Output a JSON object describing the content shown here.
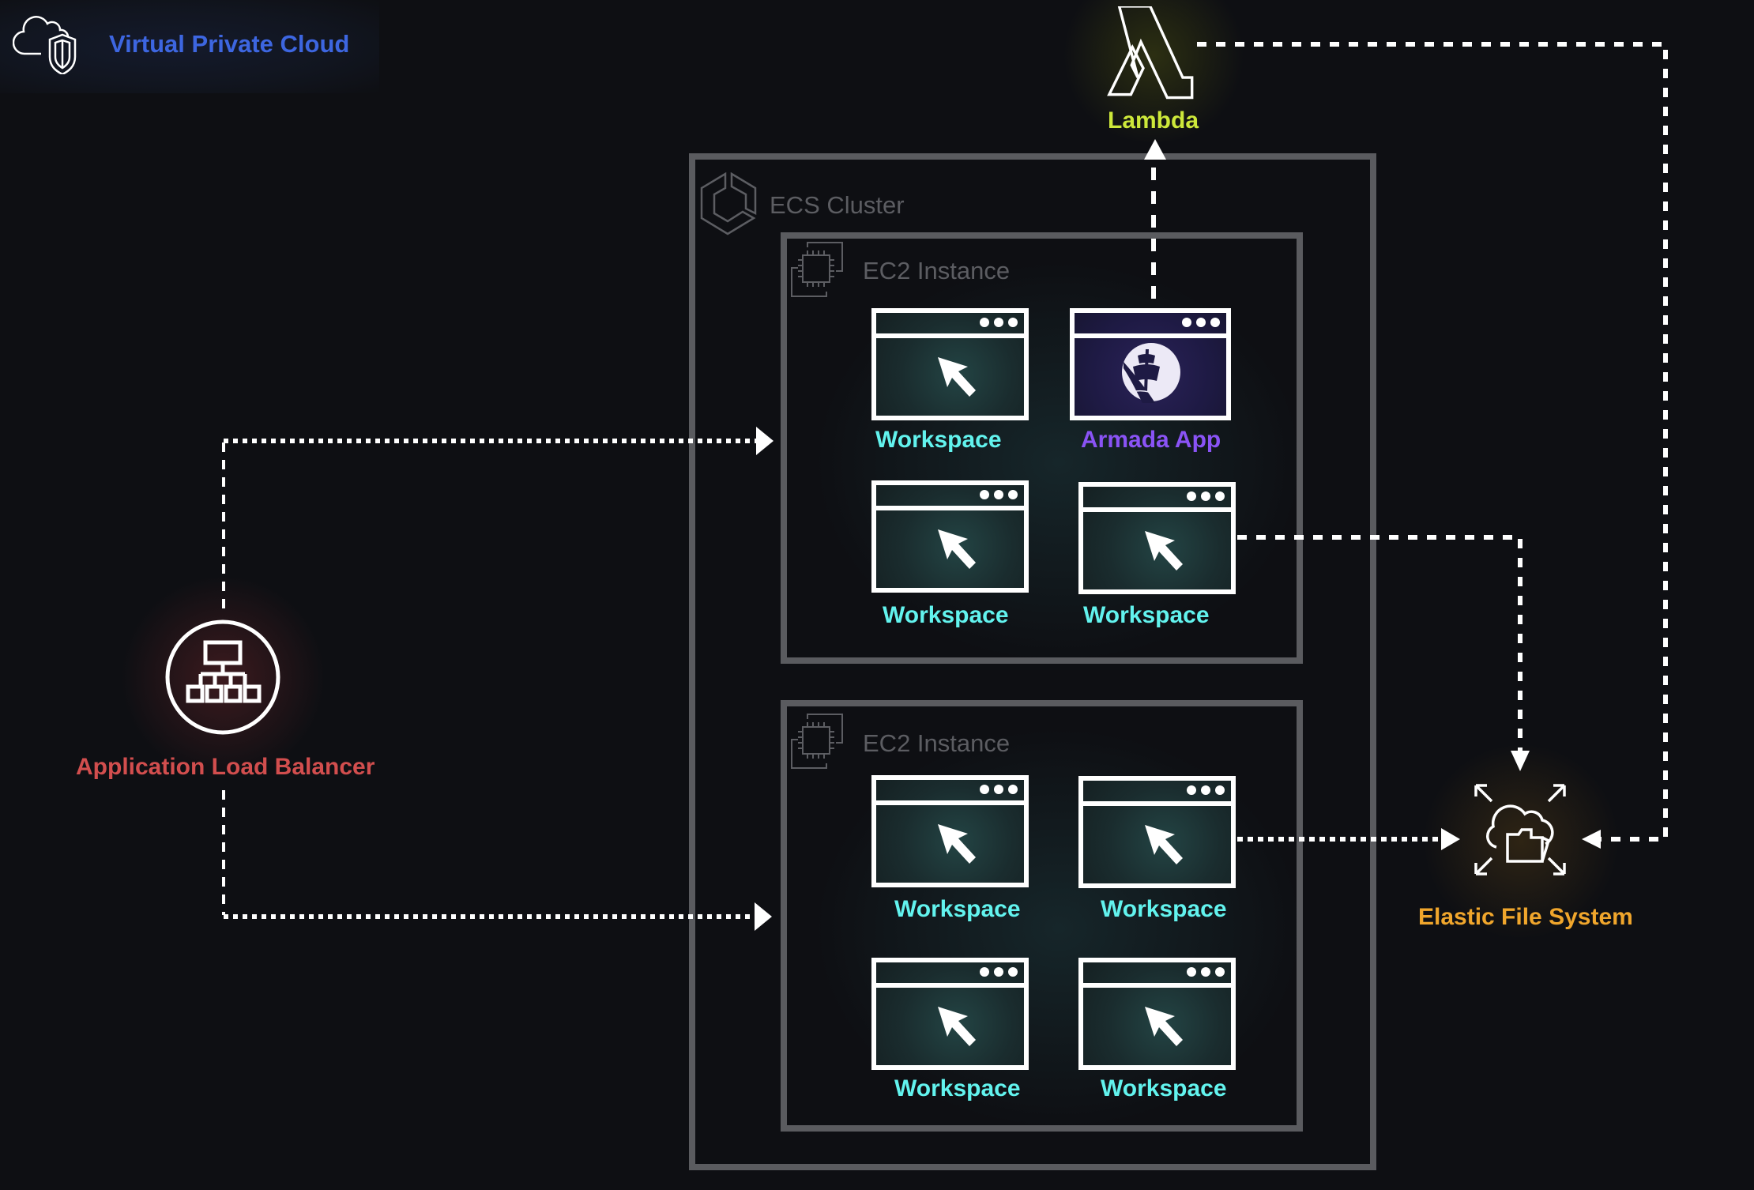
{
  "vpc": {
    "label": "Virtual Private Cloud",
    "icon": "cloud-shield-icon",
    "color": "#3d66e0"
  },
  "lambda": {
    "label": "Lambda",
    "icon": "lambda-icon",
    "color": "#cde83a"
  },
  "ecs_cluster": {
    "label": "ECS Cluster",
    "icon": "ecs-cluster-icon"
  },
  "ec2_instances": [
    {
      "label": "EC2 Instance",
      "icon": "ec2-chip-icon",
      "apps": [
        {
          "label": "Workspace",
          "type": "workspace"
        },
        {
          "label": "Armada App",
          "type": "armada"
        },
        {
          "label": "Workspace",
          "type": "workspace"
        },
        {
          "label": "Workspace",
          "type": "workspace"
        }
      ]
    },
    {
      "label": "EC2 Instance",
      "icon": "ec2-chip-icon",
      "apps": [
        {
          "label": "Workspace",
          "type": "workspace"
        },
        {
          "label": "Workspace",
          "type": "workspace"
        },
        {
          "label": "Workspace",
          "type": "workspace"
        },
        {
          "label": "Workspace",
          "type": "workspace"
        }
      ]
    }
  ],
  "alb": {
    "label": "Application Load Balancer",
    "icon": "load-balancer-icon",
    "color": "#d24e4e"
  },
  "efs": {
    "label": "Elastic File System",
    "icon": "efs-cloud-folder-icon",
    "color": "#f0a62c"
  },
  "colors": {
    "workspace_label": "#62f3ee",
    "armada_label": "#8a53f5",
    "border": "#5a5b5f",
    "background": "#0e0f13"
  },
  "connections": [
    {
      "from": "Application Load Balancer",
      "to": "EC2 Instance (top)",
      "style": "dotted"
    },
    {
      "from": "Application Load Balancer",
      "to": "EC2 Instance (bottom)",
      "style": "dotted"
    },
    {
      "from": "Armada App",
      "to": "Lambda",
      "style": "dashed"
    },
    {
      "from": "Lambda",
      "to": "Elastic File System",
      "style": "dashed"
    },
    {
      "from": "Workspace (top EC2)",
      "to": "Elastic File System",
      "style": "dashed"
    },
    {
      "from": "Workspace (bottom EC2)",
      "to": "Elastic File System",
      "style": "dotted"
    }
  ]
}
